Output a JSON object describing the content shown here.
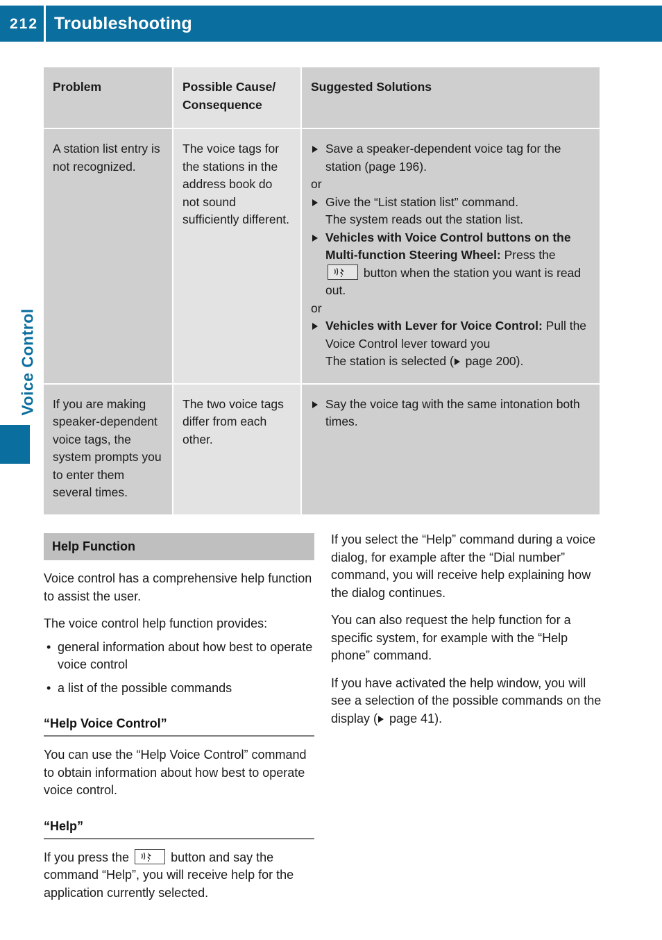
{
  "header": {
    "page_number": "212",
    "title": "Troubleshooting",
    "accent_color": "#0a6e9e"
  },
  "side_tab": {
    "label": "Voice Control"
  },
  "table": {
    "columns": [
      "Problem",
      "Possible Cause/\nConsequence",
      "Suggested Solutions"
    ],
    "col1_header": "Problem",
    "col2_header_line1": "Possible Cause/",
    "col2_header_line2": "Consequence",
    "col3_header": "Suggested Solutions",
    "rows": [
      {
        "problem": "A station list entry is not recognized.",
        "cause": "The voice tags for the stations in the address book do not sound sufficiently different.",
        "solutions": {
          "item1": "Save a speaker-dependent voice tag for the station (page 196).",
          "or1": "or",
          "item2_line1": "Give the “List station list” command.",
          "item2_line2": "The system reads out the station list.",
          "item3_bold": "Vehicles with Voice Control buttons on the Multi-function Steering Wheel:",
          "item3_pre": " Press the ",
          "item3_post": " button when the station you want is read out.",
          "or2": "or",
          "item4_bold": "Vehicles with Lever for Voice Control:",
          "item4_rest": " Pull the Voice Control lever toward you",
          "item4_line3_pre": "The station is selected (",
          "item4_line3_post": " page 200)."
        }
      },
      {
        "problem": "If you are making speaker-dependent voice tags, the system prompts you to enter them several times.",
        "cause": "The two voice tags differ from each other.",
        "solutions": {
          "item1": "Say the voice tag with the same intonation both times."
        }
      }
    ]
  },
  "left_column": {
    "section_title": "Help Function",
    "para1": "Voice control has a comprehensive help function to assist the user.",
    "para2": "The voice control help function provides:",
    "bullets": [
      "general information about how best to operate voice control",
      "a list of the possible commands"
    ],
    "sub1": {
      "heading": "“Help Voice Control”",
      "para": "You can use the “Help Voice Control” command to obtain information about how best to operate voice control."
    },
    "sub2": {
      "heading": "“Help”",
      "para_pre": "If you press the ",
      "para_post": " button and say the command “Help”, you will receive help for the application currently selected."
    }
  },
  "right_column": {
    "para1": "If you select the “Help” command during a voice dialog, for example after the “Dial number” command, you will receive help explaining how the dialog continues.",
    "para2": "You can also request the help function for a specific system, for example with the “Help phone” command.",
    "para3_pre": "If you have activated the help window, you will see a selection of the possible commands on the display (",
    "para3_post": " page 41)."
  },
  "icons": {
    "voice_button": "voice-control-button-icon",
    "page_ref": "page-reference-triangle-icon",
    "bullet_triangle": "triangle-bullet-icon"
  }
}
